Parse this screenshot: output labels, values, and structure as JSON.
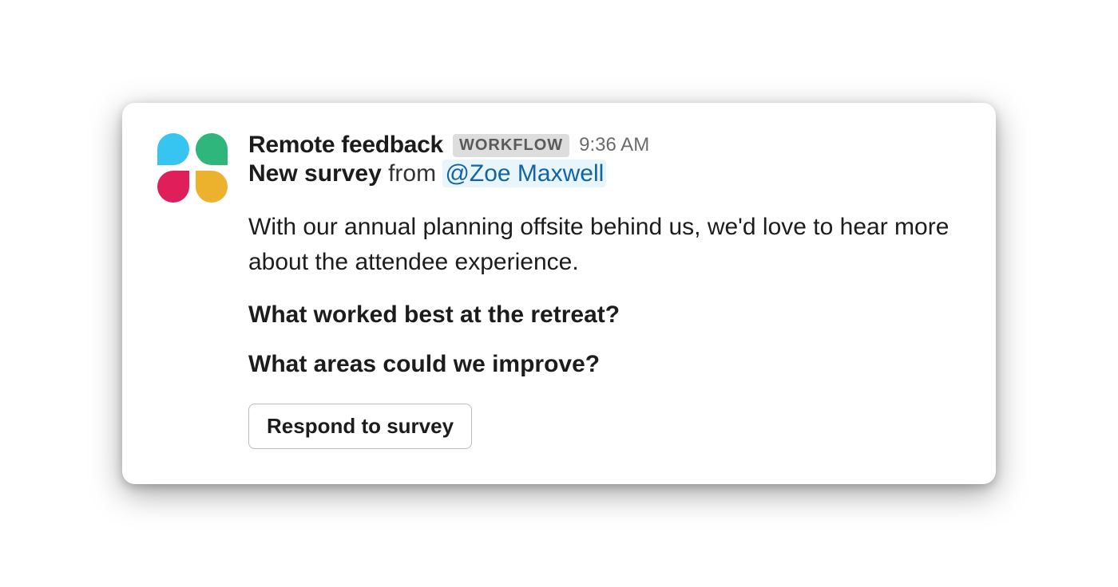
{
  "message": {
    "sender": "Remote feedback",
    "badge": "WORKFLOW",
    "timestamp": "9:36 AM",
    "subject": {
      "title": "New survey",
      "from_text": " from ",
      "mention": "@Zoe Maxwell"
    },
    "body": "With our annual planning offsite behind us, we'd love to hear more about the attendee experience.",
    "questions": [
      "What worked best at the retreat?",
      "What areas could we improve?"
    ],
    "button_label": "Respond to survey"
  }
}
